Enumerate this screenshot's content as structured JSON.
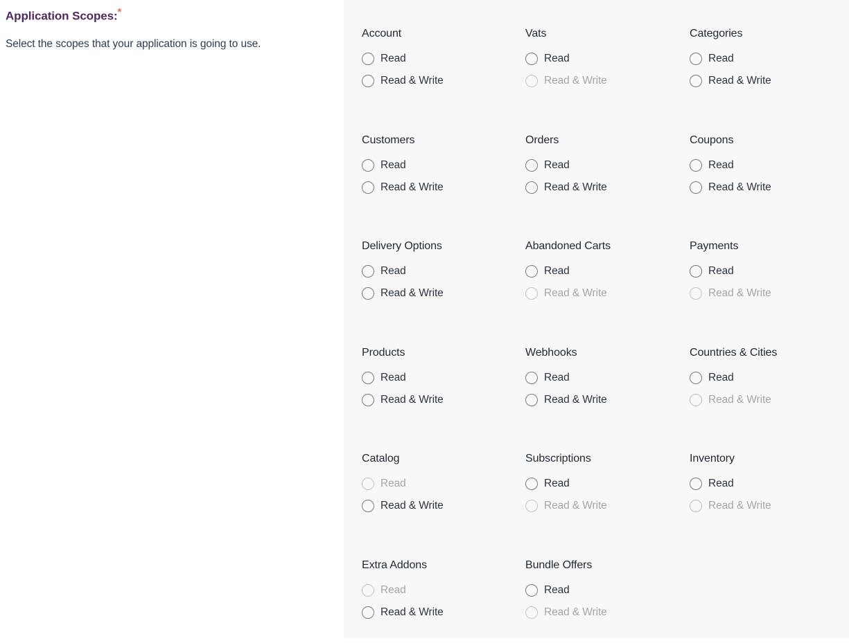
{
  "form": {
    "title": "Application Scopes:",
    "required_marker": "*",
    "description": "Select the scopes that your application is going to use."
  },
  "options": {
    "read_label": "Read",
    "read_write_label": "Read & Write"
  },
  "scope_groups": [
    {
      "name": "Account",
      "read": {
        "label": "Read",
        "disabled": false,
        "selected": false
      },
      "read_write": {
        "label": "Read & Write",
        "disabled": false,
        "selected": false
      }
    },
    {
      "name": "Vats",
      "read": {
        "label": "Read",
        "disabled": false,
        "selected": false
      },
      "read_write": {
        "label": "Read & Write",
        "disabled": true,
        "selected": false
      }
    },
    {
      "name": "Categories",
      "read": {
        "label": "Read",
        "disabled": false,
        "selected": false
      },
      "read_write": {
        "label": "Read & Write",
        "disabled": false,
        "selected": false
      }
    },
    {
      "name": "Customers",
      "read": {
        "label": "Read",
        "disabled": false,
        "selected": false
      },
      "read_write": {
        "label": "Read & Write",
        "disabled": false,
        "selected": false
      }
    },
    {
      "name": "Orders",
      "read": {
        "label": "Read",
        "disabled": false,
        "selected": false
      },
      "read_write": {
        "label": "Read & Write",
        "disabled": false,
        "selected": false
      }
    },
    {
      "name": "Coupons",
      "read": {
        "label": "Read",
        "disabled": false,
        "selected": false
      },
      "read_write": {
        "label": "Read & Write",
        "disabled": false,
        "selected": false
      }
    },
    {
      "name": "Delivery Options",
      "read": {
        "label": "Read",
        "disabled": false,
        "selected": false
      },
      "read_write": {
        "label": "Read & Write",
        "disabled": false,
        "selected": false
      }
    },
    {
      "name": "Abandoned Carts",
      "read": {
        "label": "Read",
        "disabled": false,
        "selected": false
      },
      "read_write": {
        "label": "Read & Write",
        "disabled": true,
        "selected": false
      }
    },
    {
      "name": "Payments",
      "read": {
        "label": "Read",
        "disabled": false,
        "selected": false
      },
      "read_write": {
        "label": "Read & Write",
        "disabled": true,
        "selected": false
      }
    },
    {
      "name": "Products",
      "read": {
        "label": "Read",
        "disabled": false,
        "selected": false
      },
      "read_write": {
        "label": "Read & Write",
        "disabled": false,
        "selected": false
      }
    },
    {
      "name": "Webhooks",
      "read": {
        "label": "Read",
        "disabled": false,
        "selected": false
      },
      "read_write": {
        "label": "Read & Write",
        "disabled": false,
        "selected": false
      }
    },
    {
      "name": "Countries & Cities",
      "read": {
        "label": "Read",
        "disabled": false,
        "selected": false
      },
      "read_write": {
        "label": "Read & Write",
        "disabled": true,
        "selected": false
      }
    },
    {
      "name": "Catalog",
      "read": {
        "label": "Read",
        "disabled": true,
        "selected": false
      },
      "read_write": {
        "label": "Read & Write",
        "disabled": false,
        "selected": false
      }
    },
    {
      "name": "Subscriptions",
      "read": {
        "label": "Read",
        "disabled": false,
        "selected": false
      },
      "read_write": {
        "label": "Read & Write",
        "disabled": true,
        "selected": false
      }
    },
    {
      "name": "Inventory",
      "read": {
        "label": "Read",
        "disabled": false,
        "selected": false
      },
      "read_write": {
        "label": "Read & Write",
        "disabled": true,
        "selected": false
      }
    },
    {
      "name": "Extra Addons",
      "read": {
        "label": "Read",
        "disabled": true,
        "selected": false
      },
      "read_write": {
        "label": "Read & Write",
        "disabled": false,
        "selected": false
      }
    },
    {
      "name": "Bundle Offers",
      "read": {
        "label": "Read",
        "disabled": false,
        "selected": false
      },
      "read_write": {
        "label": "Read & Write",
        "disabled": true,
        "selected": false
      }
    }
  ],
  "colors": {
    "title": "#4e2a5e",
    "required": "#ec6a6a",
    "description": "#2c3e50",
    "panel_background": "#f8f8f8",
    "page_background": "#ffffff",
    "label": "#2b3440",
    "radio_border": "#7a7a7a",
    "disabled_label": "#a6a6a6",
    "disabled_radio_border": "#c3c3c3"
  }
}
